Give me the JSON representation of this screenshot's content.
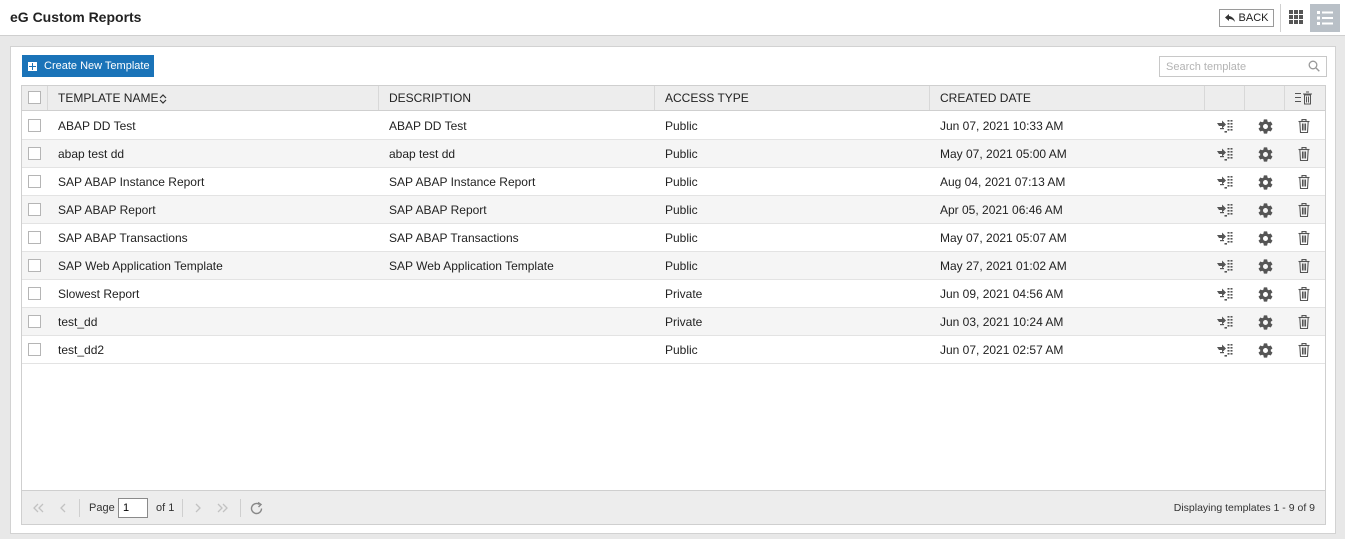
{
  "header": {
    "title": "eG Custom Reports",
    "back_label": "BACK"
  },
  "toolbar": {
    "create_label": "Create New Template",
    "search_placeholder": "Search template"
  },
  "table": {
    "columns": [
      "TEMPLATE NAME",
      "DESCRIPTION",
      "ACCESS TYPE",
      "CREATED DATE"
    ],
    "rows": [
      {
        "name": "ABAP DD Test",
        "description": "ABAP DD Test",
        "access": "Public",
        "created": "Jun 07, 2021 10:33 AM"
      },
      {
        "name": "abap test dd",
        "description": "abap test dd",
        "access": "Public",
        "created": "May 07, 2021 05:00 AM"
      },
      {
        "name": "SAP ABAP Instance Report",
        "description": "SAP ABAP Instance Report",
        "access": "Public",
        "created": "Aug 04, 2021 07:13 AM"
      },
      {
        "name": "SAP ABAP Report",
        "description": "SAP ABAP Report",
        "access": "Public",
        "created": "Apr 05, 2021 06:46 AM"
      },
      {
        "name": "SAP ABAP Transactions",
        "description": "SAP ABAP Transactions",
        "access": "Public",
        "created": "May 07, 2021 05:07 AM"
      },
      {
        "name": "SAP Web Application Template",
        "description": "SAP Web Application Template",
        "access": "Public",
        "created": "May 27, 2021 01:02 AM"
      },
      {
        "name": "Slowest Report",
        "description": "",
        "access": "Private",
        "created": "Jun 09, 2021 04:56 AM"
      },
      {
        "name": "test_dd",
        "description": "",
        "access": "Private",
        "created": "Jun 03, 2021 10:24 AM"
      },
      {
        "name": "test_dd2",
        "description": "",
        "access": "Public",
        "created": "Jun 07, 2021 02:57 AM"
      }
    ],
    "row_icons": [
      "export-template-icon",
      "gear-icon",
      "trash-icon"
    ]
  },
  "pager": {
    "page_label": "Page",
    "page_value": "1",
    "of_label": "of 1",
    "display_text": "Displaying templates 1 - 9 of 9"
  },
  "colors": {
    "accent": "#1a73b8",
    "header_bg": "#ededed",
    "active_view": "#b9c0c7"
  }
}
